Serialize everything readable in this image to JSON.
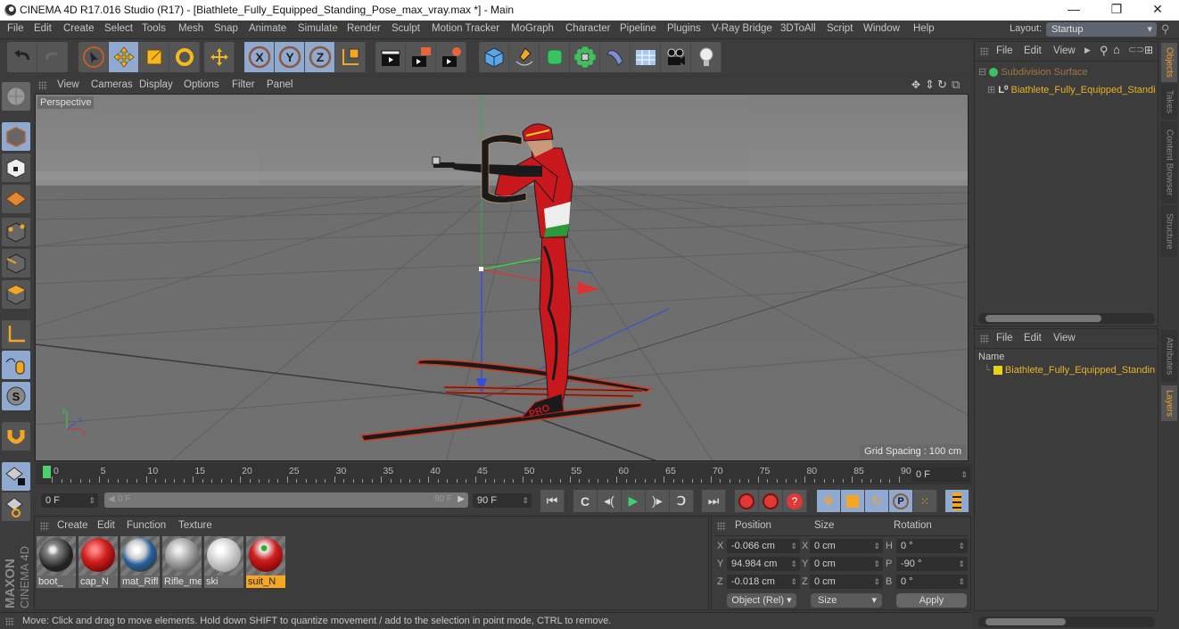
{
  "window": {
    "title": "CINEMA 4D R17.016 Studio (R17) - [Biathlete_Fully_Equipped_Standing_Pose_max_vray.max *] - Main",
    "minimize": "—",
    "restore": "❐",
    "close": "✕"
  },
  "menubar": {
    "items": [
      "File",
      "Edit",
      "Create",
      "Select",
      "Tools",
      "Mesh",
      "Snap",
      "Animate",
      "Simulate",
      "Render",
      "Sculpt",
      "Motion Tracker",
      "MoGraph",
      "Character",
      "Pipeline",
      "Plugins",
      "V-Ray Bridge",
      "3DToAll",
      "Script",
      "Window",
      "Help"
    ],
    "layout_label": "Layout:",
    "layout_value": "Startup"
  },
  "toolbar": {
    "tools": [
      "undo",
      "redo",
      "live-selection",
      "move",
      "scale",
      "rotate",
      "last-tool",
      "x-axis-lock",
      "y-axis-lock",
      "z-axis-lock",
      "coordinate-system",
      "render-view",
      "render-to-picture-viewer",
      "render-settings",
      "cube",
      "pen",
      "subdivision-surface",
      "array",
      "deformer",
      "floor",
      "camera",
      "light"
    ]
  },
  "left_toolbar": {
    "tools": [
      "make-editable",
      "model-mode",
      "texture-mode",
      "workplane-mode",
      "points-mode",
      "edges-mode",
      "polygons-mode",
      "axis-mode",
      "tweak-mode",
      "snapping",
      "magnet",
      "locked-workplane",
      "planar-workplane"
    ]
  },
  "viewport": {
    "menu": [
      "View",
      "Cameras",
      "Display",
      "Options",
      "Filter",
      "Panel"
    ],
    "label": "Perspective",
    "grid_spacing": "Grid Spacing : 100 cm",
    "axis_labels": {
      "x": "x",
      "y": "y",
      "z": "z"
    }
  },
  "timeline": {
    "ticks": [
      "0",
      "5",
      "10",
      "15",
      "20",
      "25",
      "30",
      "35",
      "40",
      "45",
      "50",
      "55",
      "60",
      "65",
      "70",
      "75",
      "80",
      "85",
      "90"
    ],
    "current_frame": "0 F",
    "start_field": "0 F",
    "range_start": "0 F",
    "range_end": "90 F",
    "end_field": "90 F"
  },
  "materials": {
    "menu": [
      "Create",
      "Edit",
      "Function",
      "Texture"
    ],
    "items": [
      {
        "name": "boot_",
        "selected": false
      },
      {
        "name": "cap_N",
        "selected": false
      },
      {
        "name": "mat_Rifl",
        "selected": false
      },
      {
        "name": "Rifle_me",
        "selected": false
      },
      {
        "name": "ski",
        "selected": false
      },
      {
        "name": "suit_N",
        "selected": true
      }
    ]
  },
  "coordinates": {
    "headers": [
      "Position",
      "Size",
      "Rotation"
    ],
    "position": {
      "X": "-0.066 cm",
      "Y": "94.984 cm",
      "Z": "-0.018 cm"
    },
    "size": {
      "X": "0 cm",
      "Y": "0 cm",
      "Z": "0 cm"
    },
    "rotation": {
      "H": "0 °",
      "P": "-90 °",
      "B": "0 °"
    },
    "mode_select": "Object (Rel)",
    "size_select": "Size",
    "apply": "Apply"
  },
  "status": {
    "text": "Move: Click and drag to move elements. Hold down SHIFT to quantize movement / add to the selection in point mode, CTRL to remove."
  },
  "object_manager": {
    "menu": [
      "File",
      "Edit",
      "View"
    ],
    "tree": [
      {
        "name": "Subdivision Surface",
        "level": 0
      },
      {
        "name": "Biathlete_Fully_Equipped_Standi",
        "level": 1
      }
    ]
  },
  "layer_manager": {
    "menu": [
      "File",
      "Edit",
      "View"
    ],
    "column": "Name",
    "items": [
      {
        "name": "Biathlete_Fully_Equipped_Standin",
        "color": "#e6d21e"
      }
    ]
  },
  "side_tabs": {
    "top": [
      {
        "label": "Objects",
        "active": true
      },
      {
        "label": "Takes",
        "active": false
      },
      {
        "label": "Content Browser",
        "active": false
      },
      {
        "label": "Structure",
        "active": false
      }
    ],
    "bottom": [
      {
        "label": "Attributes",
        "active": false
      },
      {
        "label": "Layers",
        "active": true
      }
    ]
  },
  "colors": {
    "accent_blue": "#8fa9d1",
    "orange": "#f5a623",
    "object_name": "#e6b42a"
  }
}
